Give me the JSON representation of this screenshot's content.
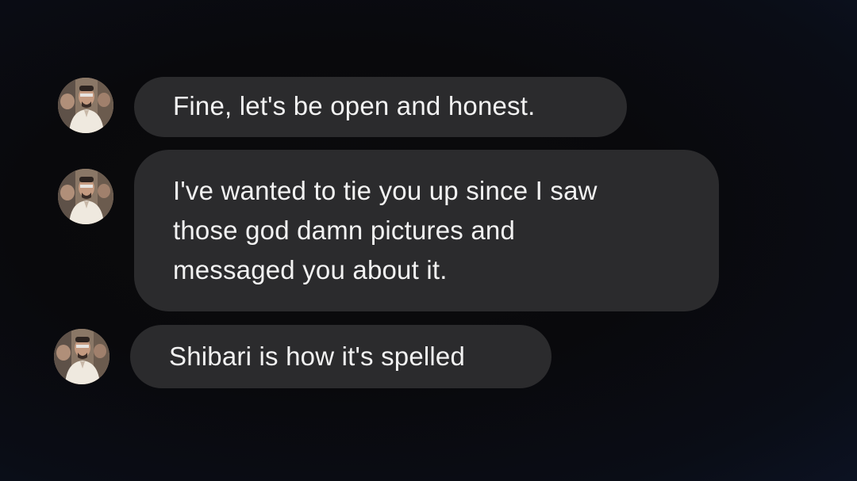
{
  "conversation": {
    "messages": [
      {
        "sender": "contact",
        "text": "Fine, let's be open and honest."
      },
      {
        "sender": "contact",
        "text": "I've wanted to tie you up since I saw\nthose god damn pictures and\nmessaged you about it."
      },
      {
        "sender": "contact",
        "text": "Shibari is how it's spelled"
      }
    ]
  },
  "colors": {
    "background": "#09090c",
    "bubble": "#2b2b2d",
    "text": "#f2f2f2"
  }
}
